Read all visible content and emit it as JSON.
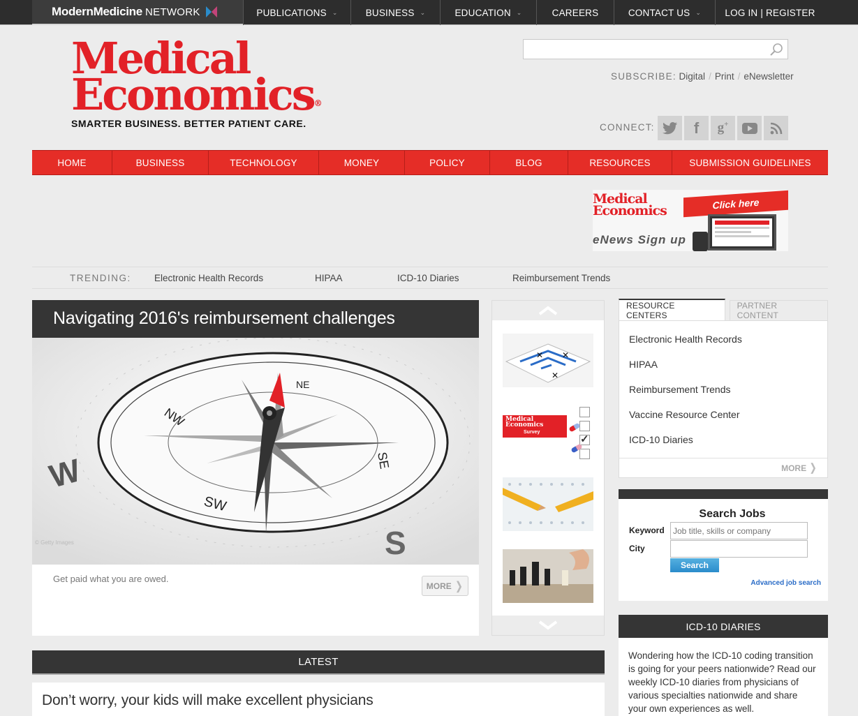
{
  "network": {
    "brand_bold": "ModernMedicine",
    "brand_light": "NETWORK",
    "nav": [
      {
        "label": "PUBLICATIONS",
        "dropdown": true
      },
      {
        "label": "BUSINESS",
        "dropdown": true
      },
      {
        "label": "EDUCATION",
        "dropdown": true
      },
      {
        "label": "CAREERS",
        "dropdown": false
      },
      {
        "label": "CONTACT US",
        "dropdown": true
      },
      {
        "label": "LOG IN | REGISTER",
        "dropdown": false
      }
    ]
  },
  "header": {
    "logo_line1": "Medical",
    "logo_line2": "Economics",
    "logo_reg": "®",
    "tagline": "SMARTER BUSINESS. BETTER PATIENT CARE.",
    "search_placeholder": "",
    "subscribe_label": "SUBSCRIBE:",
    "subscribe_links": [
      "Digital",
      "Print",
      "eNewsletter"
    ],
    "connect_label": "CONNECT:",
    "social": [
      "twitter-icon",
      "facebook-icon",
      "google-plus-icon",
      "youtube-icon",
      "rss-icon"
    ]
  },
  "main_nav": [
    "HOME",
    "BUSINESS",
    "TECHNOLOGY",
    "MONEY",
    "POLICY",
    "BLOG",
    "RESOURCES",
    "SUBMISSION GUIDELINES"
  ],
  "enews_banner": {
    "logo_line1": "Medical",
    "logo_line2": "Economics",
    "click_here": "Click here",
    "signup": "eNews Sign up"
  },
  "trending": {
    "label": "TRENDING:",
    "items": [
      "Electronic Health Records",
      "HIPAA",
      "ICD-10 Diaries",
      "Reimbursement Trends"
    ]
  },
  "feature": {
    "title": "Navigating 2016's reimbursement challenges",
    "dek": "Get paid what you are owed.",
    "image_credit": "© Getty Images",
    "more_label": "MORE"
  },
  "carousel": {
    "thumbs": [
      "maze-thumbnail",
      "survey-thumbnail",
      "broken-pencil-thumbnail",
      "chess-thumbnail"
    ],
    "survey_logo1": "Medical",
    "survey_logo2": "Economics",
    "survey_label": "Survey"
  },
  "resources": {
    "tab_active": "RESOURCE CENTERS",
    "tab_inactive": "PARTNER CONTENT",
    "items": [
      "Electronic Health Records",
      "HIPAA",
      "Reimbursement Trends",
      "Vaccine Resource Center",
      "ICD-10 Diaries"
    ],
    "more_label": "MORE"
  },
  "jobs": {
    "title": "Search Jobs",
    "keyword_label": "Keyword",
    "keyword_placeholder": "Job title, skills or company",
    "city_label": "City",
    "search_button": "Search",
    "advanced_link": "Advanced job search"
  },
  "icd10": {
    "title": "ICD-10 DIARIES",
    "body": "Wondering how the ICD-10 coding transition is going for your peers nationwide? Read our weekly ICD-10 diaries from physicians of various specialties nationwide and share your own experiences as well."
  },
  "latest": {
    "title": "LATEST",
    "stories": [
      "Don’t worry, your kids will make excellent physicians"
    ]
  },
  "colors": {
    "brand_red": "#e22127",
    "nav_red": "#e52d27",
    "dark_bar": "#353535",
    "link_blue": "#2a6cc7"
  }
}
